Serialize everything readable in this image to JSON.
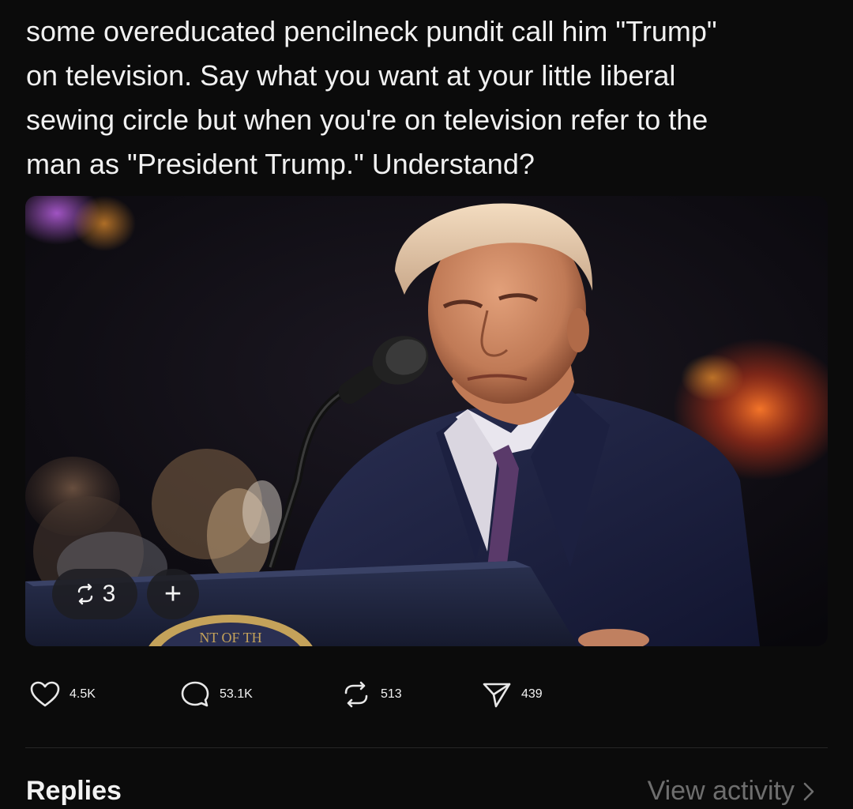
{
  "post": {
    "text_lines": [
      "some overeducated pencilneck pundit call him \"Trump\"",
      "on television.  Say what you want at your little liberal",
      "sewing circle but when you're on television refer to the",
      "man as \"President Trump.\" Understand?"
    ],
    "media": {
      "repost_chip_count": "3",
      "add_chip_label": "+",
      "seal_text": "NT OF TH"
    }
  },
  "actions": {
    "likes": "4.5K",
    "replies": "53.1K",
    "reposts": "513",
    "shares": "439"
  },
  "replies_section": {
    "title": "Replies",
    "view_activity_label": "View activity"
  },
  "colors": {
    "background": "#0b0b0b",
    "text": "#f1f1f1",
    "muted": "#6e6e6e"
  }
}
